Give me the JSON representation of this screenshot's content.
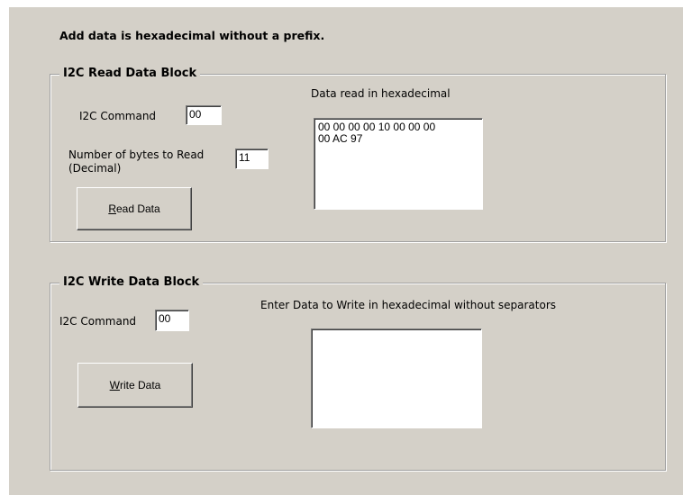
{
  "header": {
    "instruction": "Add data is hexadecimal without a prefix."
  },
  "read_block": {
    "title": "I2C Read Data Block",
    "command_label": "I2C Command",
    "command_value": "00",
    "bytes_label_line1": "Number of bytes to Read",
    "bytes_label_line2": "(Decimal)",
    "bytes_value": "11",
    "output_label": "Data read in hexadecimal",
    "output_value": "00 00 00 00 10 00 00 00\n00 AC 97",
    "button_mnemonic": "R",
    "button_rest": "ead Data"
  },
  "write_block": {
    "title": "I2C Write Data Block",
    "command_label": "I2C Command",
    "command_value": "00",
    "input_label": "Enter Data to Write in hexadecimal without separators",
    "input_value": "",
    "button_mnemonic": "W",
    "button_rest": "rite Data"
  },
  "colors": {
    "panel_background": "#d4d0c8",
    "window_background": "#ffffff"
  }
}
